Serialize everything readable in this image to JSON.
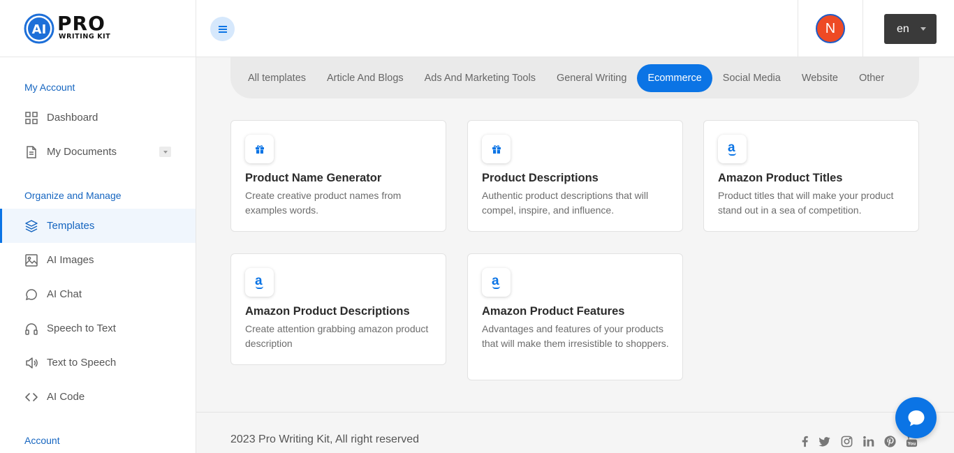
{
  "brand": {
    "logo_mark": "AI",
    "logo_main": "PRO",
    "logo_sub": "WRITING KIT"
  },
  "header": {
    "avatar_initial": "N",
    "language": "en"
  },
  "sidebar": {
    "sections": [
      "My Account",
      "Organize and Manage",
      "Account"
    ],
    "items": [
      {
        "label": "Dashboard",
        "icon": "grid-icon"
      },
      {
        "label": "My Documents",
        "icon": "document-icon"
      },
      {
        "label": "Templates",
        "icon": "layers-icon"
      },
      {
        "label": "AI Images",
        "icon": "image-icon"
      },
      {
        "label": "AI Chat",
        "icon": "chat-bubble-icon"
      },
      {
        "label": "Speech to Text",
        "icon": "headphones-icon"
      },
      {
        "label": "Text to Speech",
        "icon": "speaker-icon"
      },
      {
        "label": "AI Code",
        "icon": "code-icon"
      }
    ],
    "active_item": "Templates"
  },
  "tabs": [
    "All templates",
    "Article And Blogs",
    "Ads And Marketing Tools",
    "General Writing",
    "Ecommerce",
    "Social Media",
    "Website",
    "Other"
  ],
  "active_tab": "Ecommerce",
  "cards": [
    {
      "icon": "gift-icon",
      "title": "Product Name Generator",
      "description": "Create creative product names from examples words."
    },
    {
      "icon": "gift-icon",
      "title": "Product Descriptions",
      "description": "Authentic product descriptions that will compel, inspire, and influence."
    },
    {
      "icon": "amazon-icon",
      "title": "Amazon Product Titles",
      "description": "Product titles that will make your product stand out in a sea of competition."
    },
    {
      "icon": "amazon-icon",
      "title": "Amazon Product Descriptions",
      "description": "Create attention grabbing amazon product description"
    },
    {
      "icon": "amazon-icon",
      "title": "Amazon Product Features",
      "description": "Advantages and features of your products that will make them irresistible to shoppers."
    }
  ],
  "amazon_glyph": "a",
  "footer": {
    "copyright": "2023 Pro Writing Kit, All right reserved",
    "social": [
      "facebook-icon",
      "twitter-icon",
      "instagram-icon",
      "linkedin-icon",
      "pinterest-icon",
      "youtube-icon"
    ]
  },
  "colors": {
    "accent": "#0b74e5",
    "avatar_bg": "#ee4a24",
    "lang_bg": "#3a3a3a",
    "section_label": "#1565c0"
  }
}
